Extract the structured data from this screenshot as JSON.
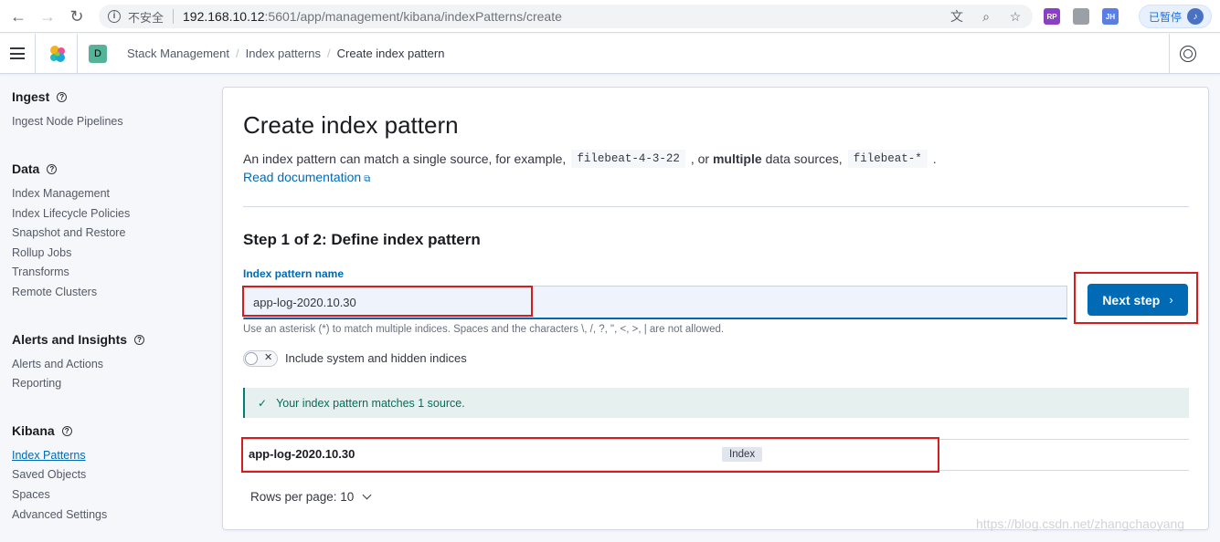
{
  "browser": {
    "insecure_label": "不安全",
    "url_host": "192.168.10.12",
    "url_rest": ":5601/app/management/kibana/indexPatterns/create",
    "paused_label": "已暂停",
    "ext_labels": [
      "RP",
      "",
      "JH"
    ]
  },
  "header": {
    "space_initial": "D",
    "breadcrumbs": [
      "Stack Management",
      "Index patterns",
      "Create index pattern"
    ]
  },
  "sidebar": {
    "groups": [
      {
        "title": "Ingest",
        "items": [
          "Ingest Node Pipelines"
        ]
      },
      {
        "title": "Data",
        "items": [
          "Index Management",
          "Index Lifecycle Policies",
          "Snapshot and Restore",
          "Rollup Jobs",
          "Transforms",
          "Remote Clusters"
        ]
      },
      {
        "title": "Alerts and Insights",
        "items": [
          "Alerts and Actions",
          "Reporting"
        ]
      },
      {
        "title": "Kibana",
        "items": [
          "Index Patterns",
          "Saved Objects",
          "Spaces",
          "Advanced Settings"
        ]
      }
    ]
  },
  "main": {
    "title": "Create index pattern",
    "desc_prefix": "An index pattern can match a single source, for example,",
    "example_single": "filebeat-4-3-22",
    "desc_or": ", or",
    "desc_multiple": "multiple",
    "desc_mid": "data sources,",
    "example_multi": "filebeat-*",
    "desc_end": ".",
    "doc_link": "Read documentation",
    "step_title": "Step 1 of 2: Define index pattern",
    "field_label": "Index pattern name",
    "input_value": "app-log-2020.10.30",
    "help_text": "Use an asterisk (*) to match multiple indices. Spaces and the characters \\, /, ?, \", <, >, | are not allowed.",
    "toggle_label": "Include system and hidden indices",
    "callout_text": "Your index pattern matches 1 source.",
    "result_name": "app-log-2020.10.30",
    "result_badge": "Index",
    "rows_per_page": "Rows per page: 10",
    "next_button": "Next step"
  },
  "watermark": "https://blog.csdn.net/zhangchaoyang"
}
